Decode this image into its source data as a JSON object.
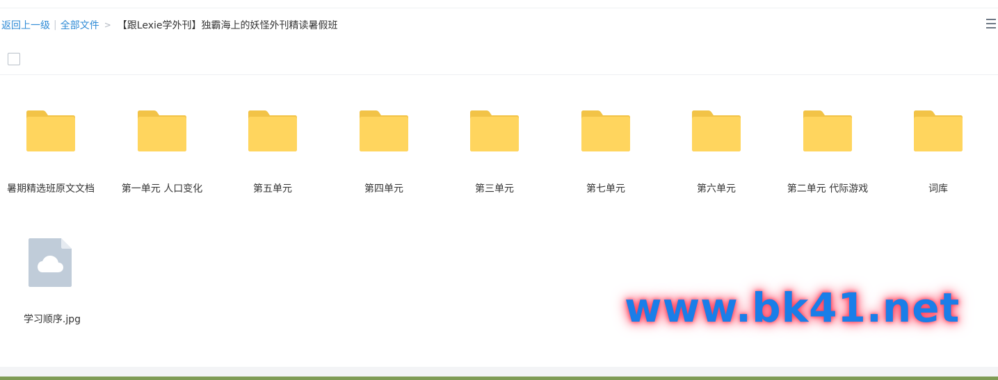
{
  "breadcrumb": {
    "back_label": "返回上一级",
    "separator": "|",
    "root_label": "全部文件",
    "arrow": ">",
    "current": "【跟Lexie学外刊】独霸海上的妖怪外刊精读暑假班"
  },
  "items": [
    {
      "type": "folder",
      "name": "暑期精选班原文文档"
    },
    {
      "type": "folder",
      "name": "第一单元 人口变化"
    },
    {
      "type": "folder",
      "name": "第五单元"
    },
    {
      "type": "folder",
      "name": "第四单元"
    },
    {
      "type": "folder",
      "name": "第三单元"
    },
    {
      "type": "folder",
      "name": "第七单元"
    },
    {
      "type": "folder",
      "name": "第六单元"
    },
    {
      "type": "folder",
      "name": "第二单元 代际游戏"
    },
    {
      "type": "folder",
      "name": "词库"
    },
    {
      "type": "image-file",
      "name": "学习顺序.jpg"
    }
  ],
  "watermark": "www.bk41.net",
  "colors": {
    "folder": "#ffd55e",
    "folder_tab": "#f2c347",
    "file_icon": "#c0ccd9",
    "link": "#2f8bd6",
    "watermark_text": "#1a7ee8",
    "watermark_glow": "#ff3b53"
  }
}
